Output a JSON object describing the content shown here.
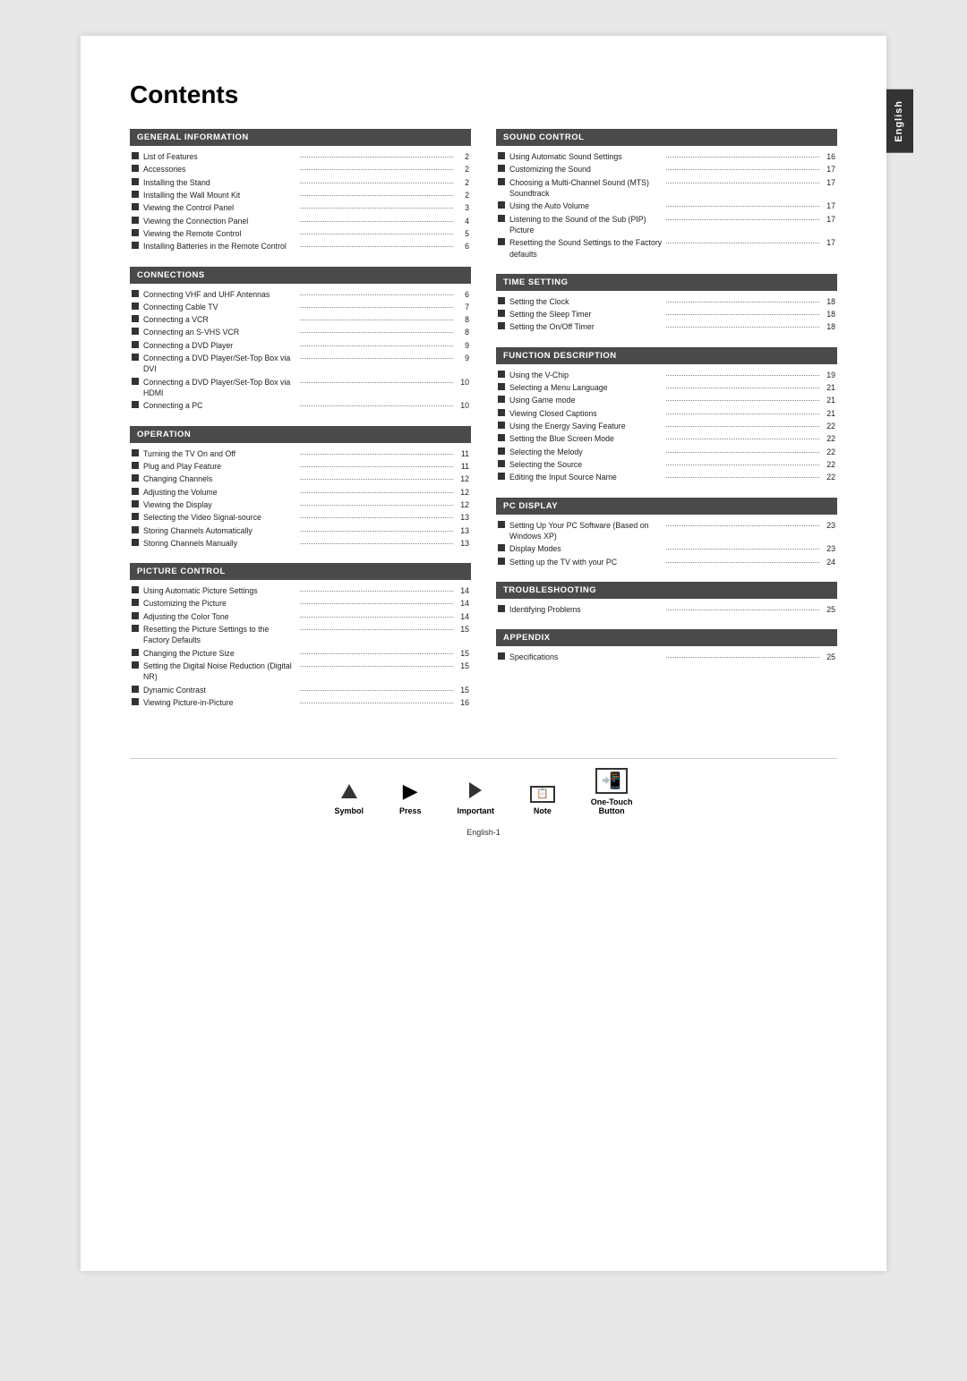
{
  "page": {
    "title": "Contents",
    "side_tab": "English",
    "footer_page": "English-1"
  },
  "legend": [
    {
      "id": "symbol",
      "label": "Symbol",
      "icon_type": "triangle"
    },
    {
      "id": "press",
      "label": "Press",
      "icon_type": "press"
    },
    {
      "id": "important",
      "label": "Important",
      "icon_type": "arrow"
    },
    {
      "id": "note",
      "label": "Note",
      "icon_type": "note"
    },
    {
      "id": "one-touch",
      "label": "One-Touch\nButton",
      "icon_type": "onetouch"
    }
  ],
  "sections_left": [
    {
      "id": "general-information",
      "header": "GENERAL INFORMATION",
      "items": [
        {
          "text": "List of Features",
          "page": "2"
        },
        {
          "text": "Accessories",
          "page": "2"
        },
        {
          "text": "Installing the Stand",
          "page": "2"
        },
        {
          "text": "Installing the Wall Mount Kit",
          "page": "2"
        },
        {
          "text": "Viewing the Control Panel",
          "page": "3"
        },
        {
          "text": "Viewing the Connection Panel",
          "page": "4"
        },
        {
          "text": "Viewing the Remote Control",
          "page": "5"
        },
        {
          "text": "Installing Batteries in the Remote Control",
          "page": "6"
        }
      ]
    },
    {
      "id": "connections",
      "header": "CONNECTIONS",
      "items": [
        {
          "text": "Connecting VHF and UHF Antennas",
          "page": "6"
        },
        {
          "text": "Connecting Cable TV",
          "page": "7"
        },
        {
          "text": "Connecting a VCR",
          "page": "8"
        },
        {
          "text": "Connecting an S-VHS VCR",
          "page": "8"
        },
        {
          "text": "Connecting a DVD Player",
          "page": "9"
        },
        {
          "text": "Connecting a DVD Player/Set-Top Box via DVI",
          "page": "9"
        },
        {
          "text": "Connecting a DVD Player/Set-Top Box via HDMI",
          "page": "10"
        },
        {
          "text": "Connecting a PC",
          "page": "10"
        }
      ]
    },
    {
      "id": "operation",
      "header": "OPERATION",
      "items": [
        {
          "text": "Turning the TV On and Off",
          "page": "11"
        },
        {
          "text": "Plug and Play Feature",
          "page": "11"
        },
        {
          "text": "Changing Channels",
          "page": "12"
        },
        {
          "text": "Adjusting the Volume",
          "page": "12"
        },
        {
          "text": "Viewing the Display",
          "page": "12"
        },
        {
          "text": "Selecting the Video Signal-source",
          "page": "13"
        },
        {
          "text": "Storing Channels Automatically",
          "page": "13"
        },
        {
          "text": "Storing Channels Manually",
          "page": "13"
        }
      ]
    },
    {
      "id": "picture-control",
      "header": "PICTURE CONTROL",
      "items": [
        {
          "text": "Using Automatic Picture Settings",
          "page": "14"
        },
        {
          "text": "Customizing the Picture",
          "page": "14"
        },
        {
          "text": "Adjusting the Color Tone",
          "page": "14"
        },
        {
          "text": "Resetting the Picture Settings to the Factory Defaults",
          "page": "15"
        },
        {
          "text": "Changing the Picture Size",
          "page": "15"
        },
        {
          "text": "Setting the Digital Noise Reduction (Digital NR)",
          "page": "15"
        },
        {
          "text": "Dynamic Contrast",
          "page": "15"
        },
        {
          "text": "Viewing Picture-in-Picture",
          "page": "16"
        }
      ]
    }
  ],
  "sections_right": [
    {
      "id": "sound-control",
      "header": "SOUND CONTROL",
      "items": [
        {
          "text": "Using Automatic Sound Settings",
          "page": "16"
        },
        {
          "text": "Customizing the Sound",
          "page": "17"
        },
        {
          "text": "Choosing a Multi-Channel Sound (MTS) Soundtrack",
          "page": "17"
        },
        {
          "text": "Using the Auto Volume",
          "page": "17"
        },
        {
          "text": "Listening to the Sound of the Sub (PIP) Picture",
          "page": "17"
        },
        {
          "text": "Resetting the Sound Settings to the Factory defaults",
          "page": "17"
        }
      ]
    },
    {
      "id": "time-setting",
      "header": "TIME SETTING",
      "items": [
        {
          "text": "Setting the Clock",
          "page": "18"
        },
        {
          "text": "Setting the Sleep Timer",
          "page": "18"
        },
        {
          "text": "Setting the On/Off Timer",
          "page": "18"
        }
      ]
    },
    {
      "id": "function-description",
      "header": "FUNCTION DESCRIPTION",
      "items": [
        {
          "text": "Using the V-Chip",
          "page": "19"
        },
        {
          "text": "Selecting a Menu Language",
          "page": "21"
        },
        {
          "text": "Using Game mode",
          "page": "21"
        },
        {
          "text": "Viewing Closed Captions",
          "page": "21"
        },
        {
          "text": "Using the Energy Saving Feature",
          "page": "22"
        },
        {
          "text": "Setting the Blue Screen Mode",
          "page": "22"
        },
        {
          "text": "Selecting the Melody",
          "page": "22"
        },
        {
          "text": "Selecting the Source",
          "page": "22"
        },
        {
          "text": "Editing the Input Source Name",
          "page": "22"
        }
      ]
    },
    {
      "id": "pc-display",
      "header": "PC DISPLAY",
      "items": [
        {
          "text": "Setting Up Your PC Software (Based on Windows XP)",
          "page": "23"
        },
        {
          "text": "Display Modes",
          "page": "23"
        },
        {
          "text": "Setting up the TV with your PC",
          "page": "24"
        }
      ]
    },
    {
      "id": "troubleshooting",
      "header": "TROUBLESHOOTING",
      "items": [
        {
          "text": "Identifying Problems",
          "page": "25"
        }
      ]
    },
    {
      "id": "appendix",
      "header": "APPENDIX",
      "items": [
        {
          "text": "Specifications",
          "page": "25"
        }
      ]
    }
  ]
}
